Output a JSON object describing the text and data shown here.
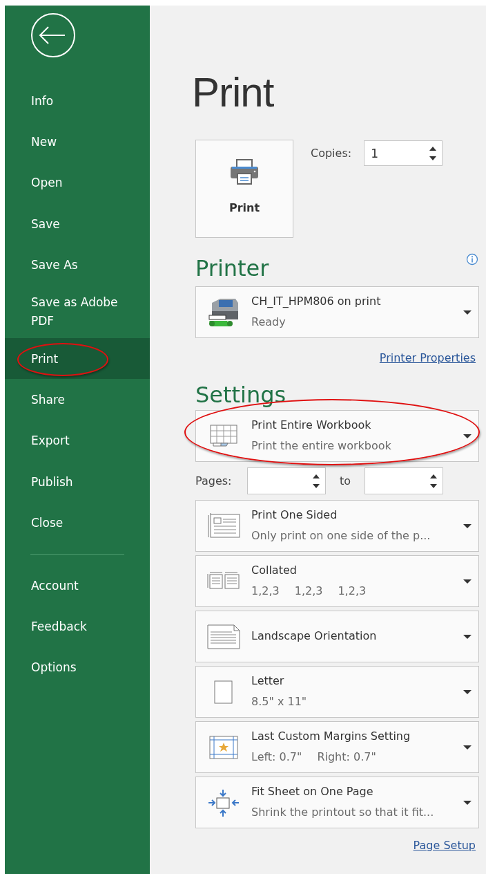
{
  "sidebar": {
    "items": [
      {
        "label": "Info",
        "selected": false,
        "circled": false
      },
      {
        "label": "New",
        "selected": false,
        "circled": false
      },
      {
        "label": "Open",
        "selected": false,
        "circled": false
      },
      {
        "label": "Save",
        "selected": false,
        "circled": false
      },
      {
        "label": "Save As",
        "selected": false,
        "circled": false
      },
      {
        "label": "Save as Adobe PDF",
        "selected": false,
        "circled": false
      },
      {
        "label": "Print",
        "selected": true,
        "circled": true
      },
      {
        "label": "Share",
        "selected": false,
        "circled": false
      },
      {
        "label": "Export",
        "selected": false,
        "circled": false
      },
      {
        "label": "Publish",
        "selected": false,
        "circled": false
      },
      {
        "label": "Close",
        "selected": false,
        "circled": false
      }
    ],
    "bottom_items": [
      {
        "label": "Account",
        "selected": false
      },
      {
        "label": "Feedback",
        "selected": false
      },
      {
        "label": "Options",
        "selected": false
      }
    ]
  },
  "title": "Print",
  "print_button": "Print",
  "copies": {
    "label": "Copies:",
    "value": "1"
  },
  "printer": {
    "heading": "Printer",
    "name": "CH_IT_HPM806 on print",
    "status": "Ready",
    "properties_link": "Printer Properties"
  },
  "settings": {
    "heading": "Settings",
    "items": [
      {
        "kind": "workbook",
        "title": "Print Entire Workbook",
        "subtitle": [
          "Print the entire workbook"
        ],
        "circled": true
      },
      {
        "kind": "pages",
        "label": "Pages:",
        "to": "to"
      },
      {
        "kind": "sided",
        "title": "Print One Sided",
        "subtitle": [
          "Only print on one side of the p..."
        ],
        "circled": false
      },
      {
        "kind": "collated",
        "title": "Collated",
        "subtitle": [
          "1,2,3",
          "1,2,3",
          "1,2,3"
        ],
        "circled": false
      },
      {
        "kind": "orientation",
        "title": "Landscape Orientation",
        "circled": false
      },
      {
        "kind": "paper",
        "title": "Letter",
        "subtitle": [
          "8.5\" x 11\""
        ],
        "circled": false
      },
      {
        "kind": "margins",
        "title": "Last Custom Margins Setting",
        "subtitle": [
          "Left:  0.7\"",
          "Right:  0.7\""
        ],
        "circled": false
      },
      {
        "kind": "scaling",
        "title": "Fit Sheet on One Page",
        "subtitle": [
          "Shrink the printout so that it fit..."
        ],
        "circled": false
      }
    ],
    "page_setup_link": "Page Setup"
  }
}
